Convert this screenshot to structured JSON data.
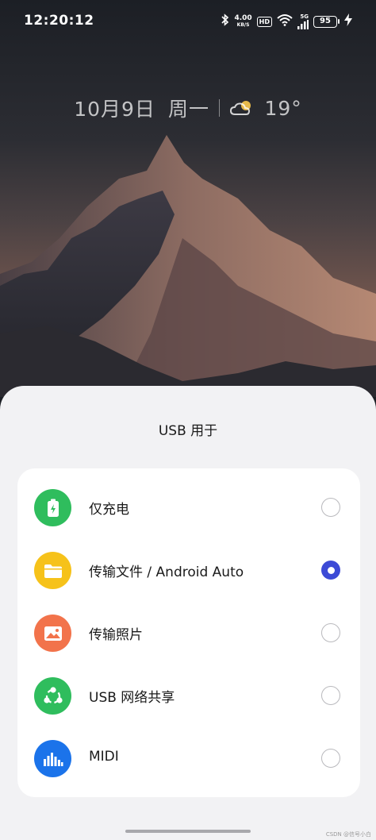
{
  "status_bar": {
    "time": "12:20:12",
    "net_speed": "4.00",
    "net_unit": "KB/S",
    "hd_badge": "HD",
    "signal_label": "5G",
    "battery": "95",
    "icons": [
      "bluetooth-icon",
      "wifi-icon",
      "signal-icon",
      "charging-icon"
    ]
  },
  "lock_screen": {
    "date": "10月9日",
    "weekday": "周一",
    "temperature": "19°",
    "weather_icon": "partly-cloudy-icon"
  },
  "usb_sheet": {
    "title": "USB 用于",
    "options": [
      {
        "label": "仅充电",
        "icon": "battery-charge-icon",
        "color": "#2fbd5d",
        "selected": false
      },
      {
        "label": "传输文件 / Android Auto",
        "icon": "folder-icon",
        "color": "#f6c21a",
        "selected": true
      },
      {
        "label": "传输照片",
        "icon": "photo-icon",
        "color": "#f2734b",
        "selected": false
      },
      {
        "label": "USB 网络共享",
        "icon": "share-network-icon",
        "color": "#2fbd5d",
        "selected": false
      },
      {
        "label": "MIDI",
        "icon": "equalizer-icon",
        "color": "#1b73ea",
        "selected": false
      }
    ],
    "accent_color": "#3c4ad6"
  },
  "watermark": "CSDN @信号小白"
}
